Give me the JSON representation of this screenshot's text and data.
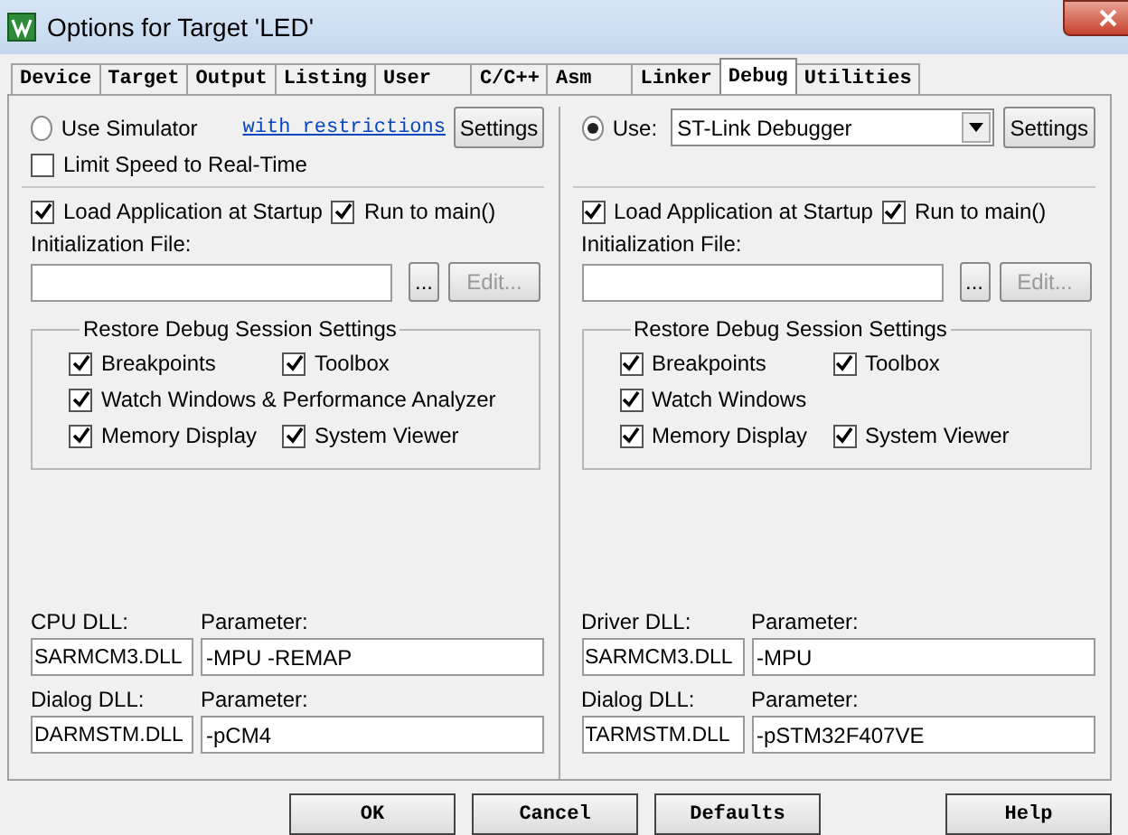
{
  "window": {
    "title": "Options for Target 'LED'"
  },
  "tabs": [
    {
      "label": "Device",
      "selected": false
    },
    {
      "label": "Target",
      "selected": false
    },
    {
      "label": "Output",
      "selected": false
    },
    {
      "label": "Listing",
      "selected": false
    },
    {
      "label": "User",
      "selected": false
    },
    {
      "label": "C/C++",
      "selected": false
    },
    {
      "label": "Asm",
      "selected": false
    },
    {
      "label": "Linker",
      "selected": false
    },
    {
      "label": "Debug",
      "selected": true
    },
    {
      "label": "Utilities",
      "selected": false
    }
  ],
  "panels": [
    {
      "kind": "simulator",
      "mode": {
        "label": "Use Simulator",
        "selected": false
      },
      "link": "with restrictions",
      "settings_button": "Settings",
      "limit_speed": {
        "label": "Limit Speed to Real-Time",
        "checked": false
      },
      "load_app": {
        "label": "Load Application at Startup",
        "checked": true
      },
      "run_to_main": {
        "label": "Run to main()",
        "checked": true
      },
      "init_file_label": "Initialization File:",
      "browse_button": "...",
      "edit_button": {
        "label": "Edit...",
        "disabled": true
      },
      "restore": {
        "title": "Restore Debug Session Settings",
        "rows": [
          [
            {
              "label": "Breakpoints",
              "checked": true
            },
            {
              "label": "Toolbox",
              "checked": true
            }
          ],
          [
            {
              "label": "Watch Windows & Performance Analyzer",
              "checked": true
            }
          ],
          [
            {
              "label": "Memory Display",
              "checked": true
            },
            {
              "label": "System Viewer",
              "checked": true
            }
          ]
        ]
      },
      "dlls": [
        {
          "dll_label": "CPU DLL:",
          "dll": "SARMCM3.DLL",
          "param_label": "Parameter:",
          "param": "-MPU -REMAP"
        },
        {
          "dll_label": "Dialog DLL:",
          "dll": "DARMSTM.DLL",
          "param_label": "Parameter:",
          "param": "-pCM4"
        }
      ]
    },
    {
      "kind": "target",
      "mode": {
        "label": "Use:",
        "selected": true
      },
      "driver": "ST-Link Debugger",
      "settings_button": "Settings",
      "load_app": {
        "label": "Load Application at Startup",
        "checked": true
      },
      "run_to_main": {
        "label": "Run to main()",
        "checked": true
      },
      "init_file_label": "Initialization File:",
      "browse_button": "...",
      "edit_button": {
        "label": "Edit...",
        "disabled": true
      },
      "restore": {
        "title": "Restore Debug Session Settings",
        "rows": [
          [
            {
              "label": "Breakpoints",
              "checked": true
            },
            {
              "label": "Toolbox",
              "checked": true
            }
          ],
          [
            {
              "label": "Watch Windows",
              "checked": true
            }
          ],
          [
            {
              "label": "Memory Display",
              "checked": true
            },
            {
              "label": "System Viewer",
              "checked": true
            }
          ]
        ]
      },
      "dlls": [
        {
          "dll_label": "Driver DLL:",
          "dll": "SARMCM3.DLL",
          "param_label": "Parameter:",
          "param": "-MPU"
        },
        {
          "dll_label": "Dialog DLL:",
          "dll": "TARMSTM.DLL",
          "param_label": "Parameter:",
          "param": "-pSTM32F407VE"
        }
      ]
    }
  ],
  "buttons": [
    "OK",
    "Cancel",
    "Defaults",
    "Help"
  ]
}
